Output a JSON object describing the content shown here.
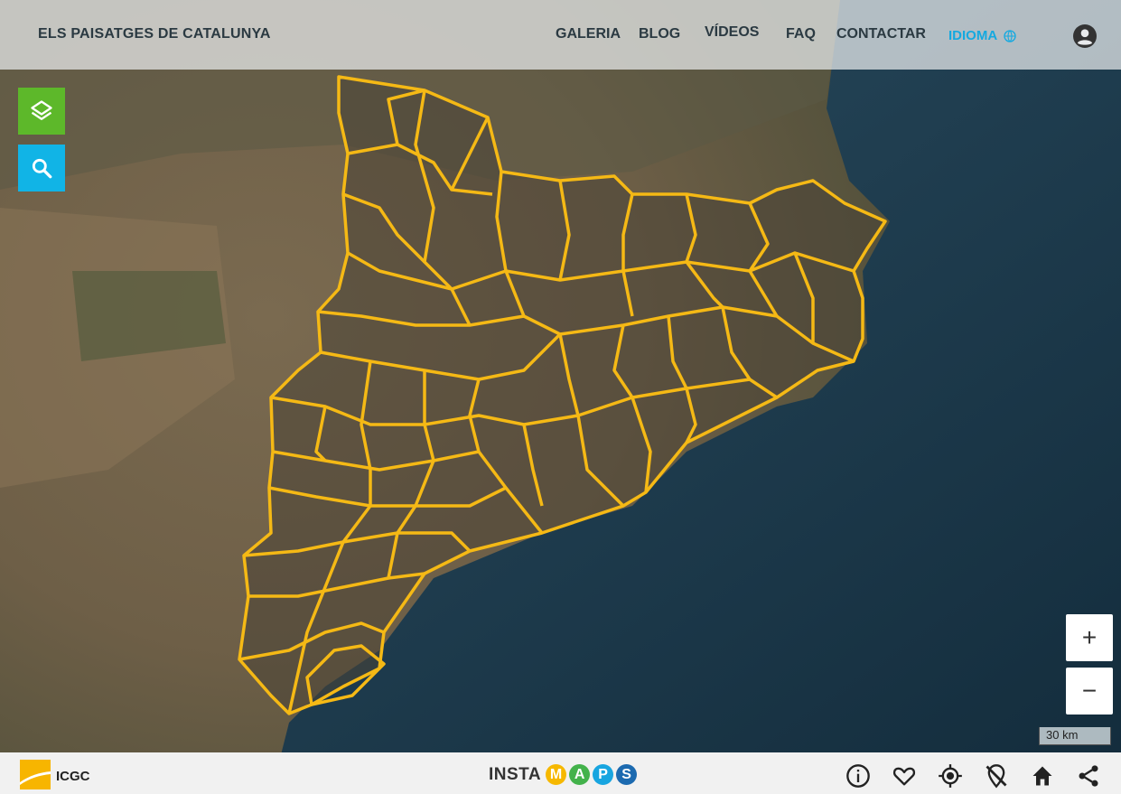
{
  "header": {
    "brand": "ELS PAISATGES DE CATALUNYA",
    "nav": [
      "GALERIA",
      "BLOG",
      "VÍDEOS",
      "FAQ",
      "CONTACTAR"
    ],
    "language_label": "IDIOMA",
    "language_icon": "globe-icon",
    "user_icon": "account-circle-icon"
  },
  "map_controls": {
    "layers_icon": "layers-icon",
    "search_icon": "search-icon",
    "zoom_in": "+",
    "zoom_out": "−",
    "scale_label": "30 km"
  },
  "footer": {
    "icgc_label": "ICGC",
    "instamaps_prefix": "INSTA",
    "instamaps_letters": [
      "M",
      "A",
      "P",
      "S"
    ],
    "icons": [
      "info-icon",
      "heart-icon",
      "my-location-icon",
      "location-off-icon",
      "home-icon",
      "share-icon"
    ]
  },
  "colors": {
    "accent_blue": "#14a9e0",
    "layers_green": "#5db82a",
    "search_blue": "#11b4e6",
    "border_yellow": "#f5b915",
    "instamaps": [
      "#f6b800",
      "#43b24b",
      "#18a5e0",
      "#1c6ab0"
    ]
  }
}
